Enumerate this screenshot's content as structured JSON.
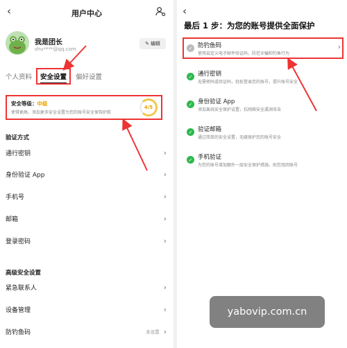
{
  "left": {
    "title": "用户中心",
    "profile": {
      "name": "我是团长",
      "email": "shu****@qq.com",
      "edit_label": "编辑"
    },
    "tabs": [
      {
        "label": "个人资料",
        "active": false
      },
      {
        "label": "安全设置",
        "active": true
      },
      {
        "label": "偏好设置",
        "active": false
      }
    ],
    "security": {
      "title_prefix": "安全等级：",
      "level": "中级",
      "desc": "使得更高，添加更多安全设置为您的账号安全保驾护航",
      "score": "4/5"
    },
    "verify_section": {
      "heading": "验证方式",
      "items": [
        "通行密钥",
        "身份验证 App",
        "手机号",
        "邮箱",
        "登录密码"
      ]
    },
    "advanced_section": {
      "heading": "高级安全设置",
      "items": [
        {
          "label": "紧急联系人",
          "value": ""
        },
        {
          "label": "设备管理",
          "value": ""
        },
        {
          "label": "防钓鱼码",
          "value": "未设置"
        }
      ]
    }
  },
  "right": {
    "title": "最后 1 步：为您的账号提供全面保护",
    "items": [
      {
        "title": "防钓鱼码",
        "desc": "使用自定义电子邮件验证码，防范诈骗和钓鱼行为",
        "done": false
      },
      {
        "title": "通行密钥",
        "desc": "无需密码或验证码，轻松登录您的账号，提升账号安全",
        "done": true
      },
      {
        "title": "身份验证 App",
        "desc": "添加离线安全保护设置，抗网络安全漏洞攻击",
        "done": true
      },
      {
        "title": "验证邮箱",
        "desc": "通过简单的安全设置，无缝保护您的账号安全",
        "done": true
      },
      {
        "title": "手机验证",
        "desc": "为您的账号增加额外一层安全保护措施，助您找回账号",
        "done": true
      }
    ]
  },
  "watermark": "yabovip.com.cn",
  "colors": {
    "highlight_red": "#e33333",
    "success_green": "#2db84d",
    "level_amber": "#e8a200"
  }
}
